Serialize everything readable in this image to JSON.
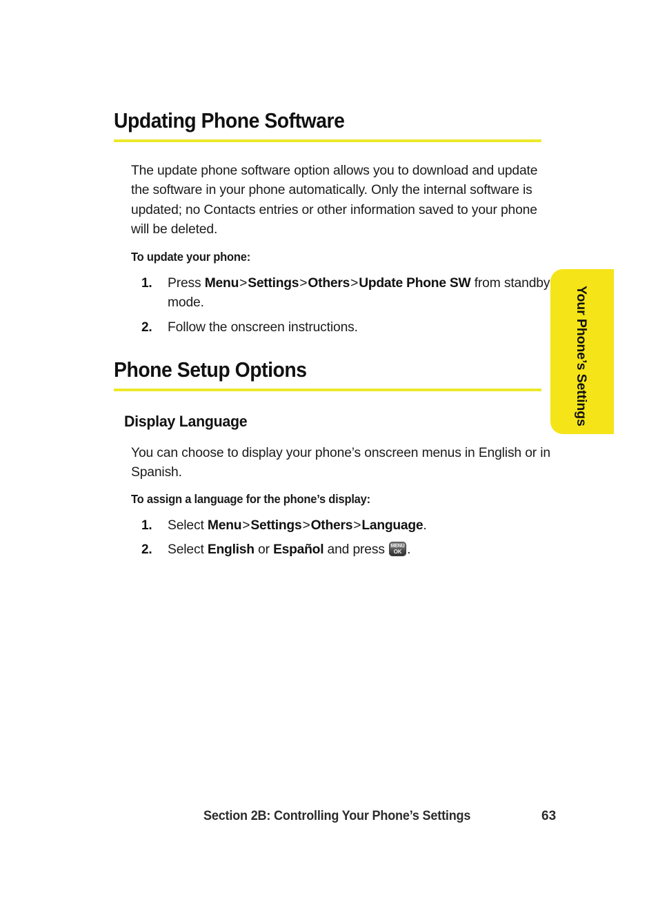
{
  "page": {
    "number": "63",
    "footer_text": "Section 2B: Controlling Your Phone’s Settings"
  },
  "side_tab": {
    "label": "Your Phone’s Settings",
    "color": "#f5e418"
  },
  "rule_color": "#ece92a",
  "sections": [
    {
      "title": "Updating Phone Software",
      "body": "The update phone software option allows you to download and update the software in your phone automatically. Only the internal software is updated; no Contacts entries or other information saved to your phone will be deleted.",
      "lead_in": "To update your phone:",
      "steps": [
        {
          "number": "1.",
          "prefix": "Press ",
          "path": [
            "Menu",
            "Settings",
            "Others",
            "Update Phone SW"
          ],
          "suffix": " from standby mode."
        },
        {
          "number": "2.",
          "prefix": "Follow the onscreen instructions.",
          "path": [],
          "suffix": ""
        }
      ]
    },
    {
      "title": "Phone Setup Options",
      "subtitle": "Display Language",
      "body": "You can choose to display your phone’s onscreen menus in English or in Spanish.",
      "lead_in": "To assign a language for the phone’s display:",
      "steps": [
        {
          "number": "1.",
          "prefix": "Select ",
          "path": [
            "Menu",
            "Settings",
            "Others",
            "Language"
          ],
          "suffix": "."
        },
        {
          "number": "2.",
          "prefix": "Select ",
          "options": [
            "English",
            "Español"
          ],
          "joiner": " or ",
          "middle": " and press ",
          "suffix": "."
        }
      ]
    }
  ],
  "key_icon": {
    "line1": "MENU",
    "line2": "OK",
    "name": "menu-ok-key-icon"
  },
  "separator": ">"
}
